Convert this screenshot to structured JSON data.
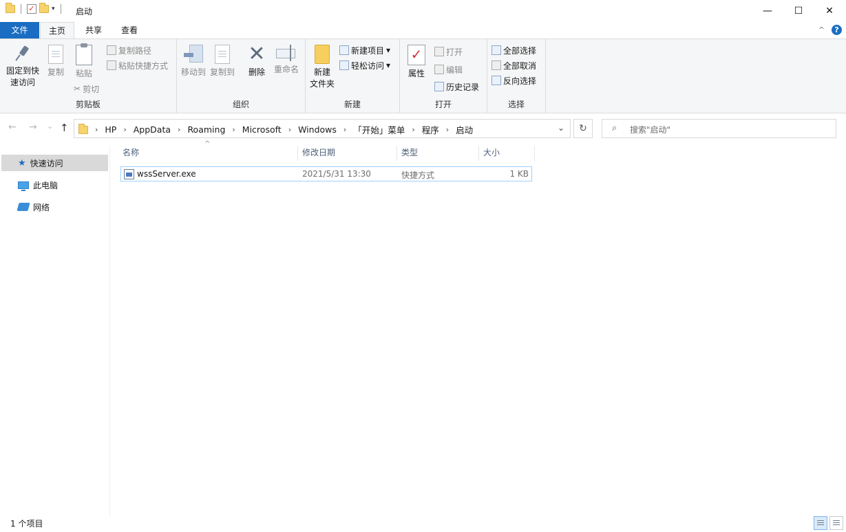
{
  "window": {
    "title": "启动",
    "minimize_glyph": "—",
    "maximize_glyph": "☐",
    "close_glyph": "✕"
  },
  "qat": {
    "dropdown_glyph": "▾"
  },
  "ribbon_tabs": {
    "file": "文件",
    "home": "主页",
    "share": "共享",
    "view": "查看",
    "collapse_glyph": "^",
    "help_glyph": "?"
  },
  "clipboard": {
    "pin_label_1": "固定到快",
    "pin_label_2": "速访问",
    "copy": "复制",
    "paste": "粘贴",
    "copy_path": "复制路径",
    "paste_shortcut": "粘贴快捷方式",
    "cut": "剪切",
    "group": "剪贴板"
  },
  "organize": {
    "move_to": "移动到",
    "copy_to": "复制到",
    "delete": "删除",
    "rename": "重命名",
    "group": "组织"
  },
  "new": {
    "new_folder_1": "新建",
    "new_folder_2": "文件夹",
    "new_item": "新建项目",
    "easy_access": "轻松访问",
    "group": "新建"
  },
  "open": {
    "properties": "属性",
    "open": "打开",
    "edit": "编辑",
    "history": "历史记录",
    "group": "打开"
  },
  "select": {
    "select_all": "全部选择",
    "select_none": "全部取消",
    "invert": "反向选择",
    "group": "选择"
  },
  "nav": {
    "back": "←",
    "forward": "→",
    "recent": "⌄",
    "up": "↑",
    "refresh": "↻"
  },
  "address": {
    "crumbs": [
      "HP",
      "AppData",
      "Roaming",
      "Microsoft",
      "Windows",
      "「开始」菜单",
      "程序",
      "启动"
    ],
    "separator": "›",
    "dropdown": "⌄"
  },
  "search": {
    "placeholder": "搜索\"启动\"",
    "icon": "⌕"
  },
  "navpane": {
    "items": [
      {
        "label": "快速访问",
        "icon": "star-icon"
      },
      {
        "label": "此电脑",
        "icon": "computer-icon"
      },
      {
        "label": "网络",
        "icon": "network-icon"
      }
    ]
  },
  "columns": {
    "name": "名称",
    "modified": "修改日期",
    "type": "类型",
    "size": "大小",
    "sort_glyph": "^"
  },
  "files": [
    {
      "name": "wssServer.exe",
      "modified": "2021/5/31 13:30",
      "type": "快捷方式",
      "size": "1 KB"
    }
  ],
  "status": {
    "count": "1 个项目"
  },
  "colors": {
    "accent": "#1a6dc2",
    "ribbon_bg": "#f5f6f7",
    "selection": "#99d1ff"
  }
}
